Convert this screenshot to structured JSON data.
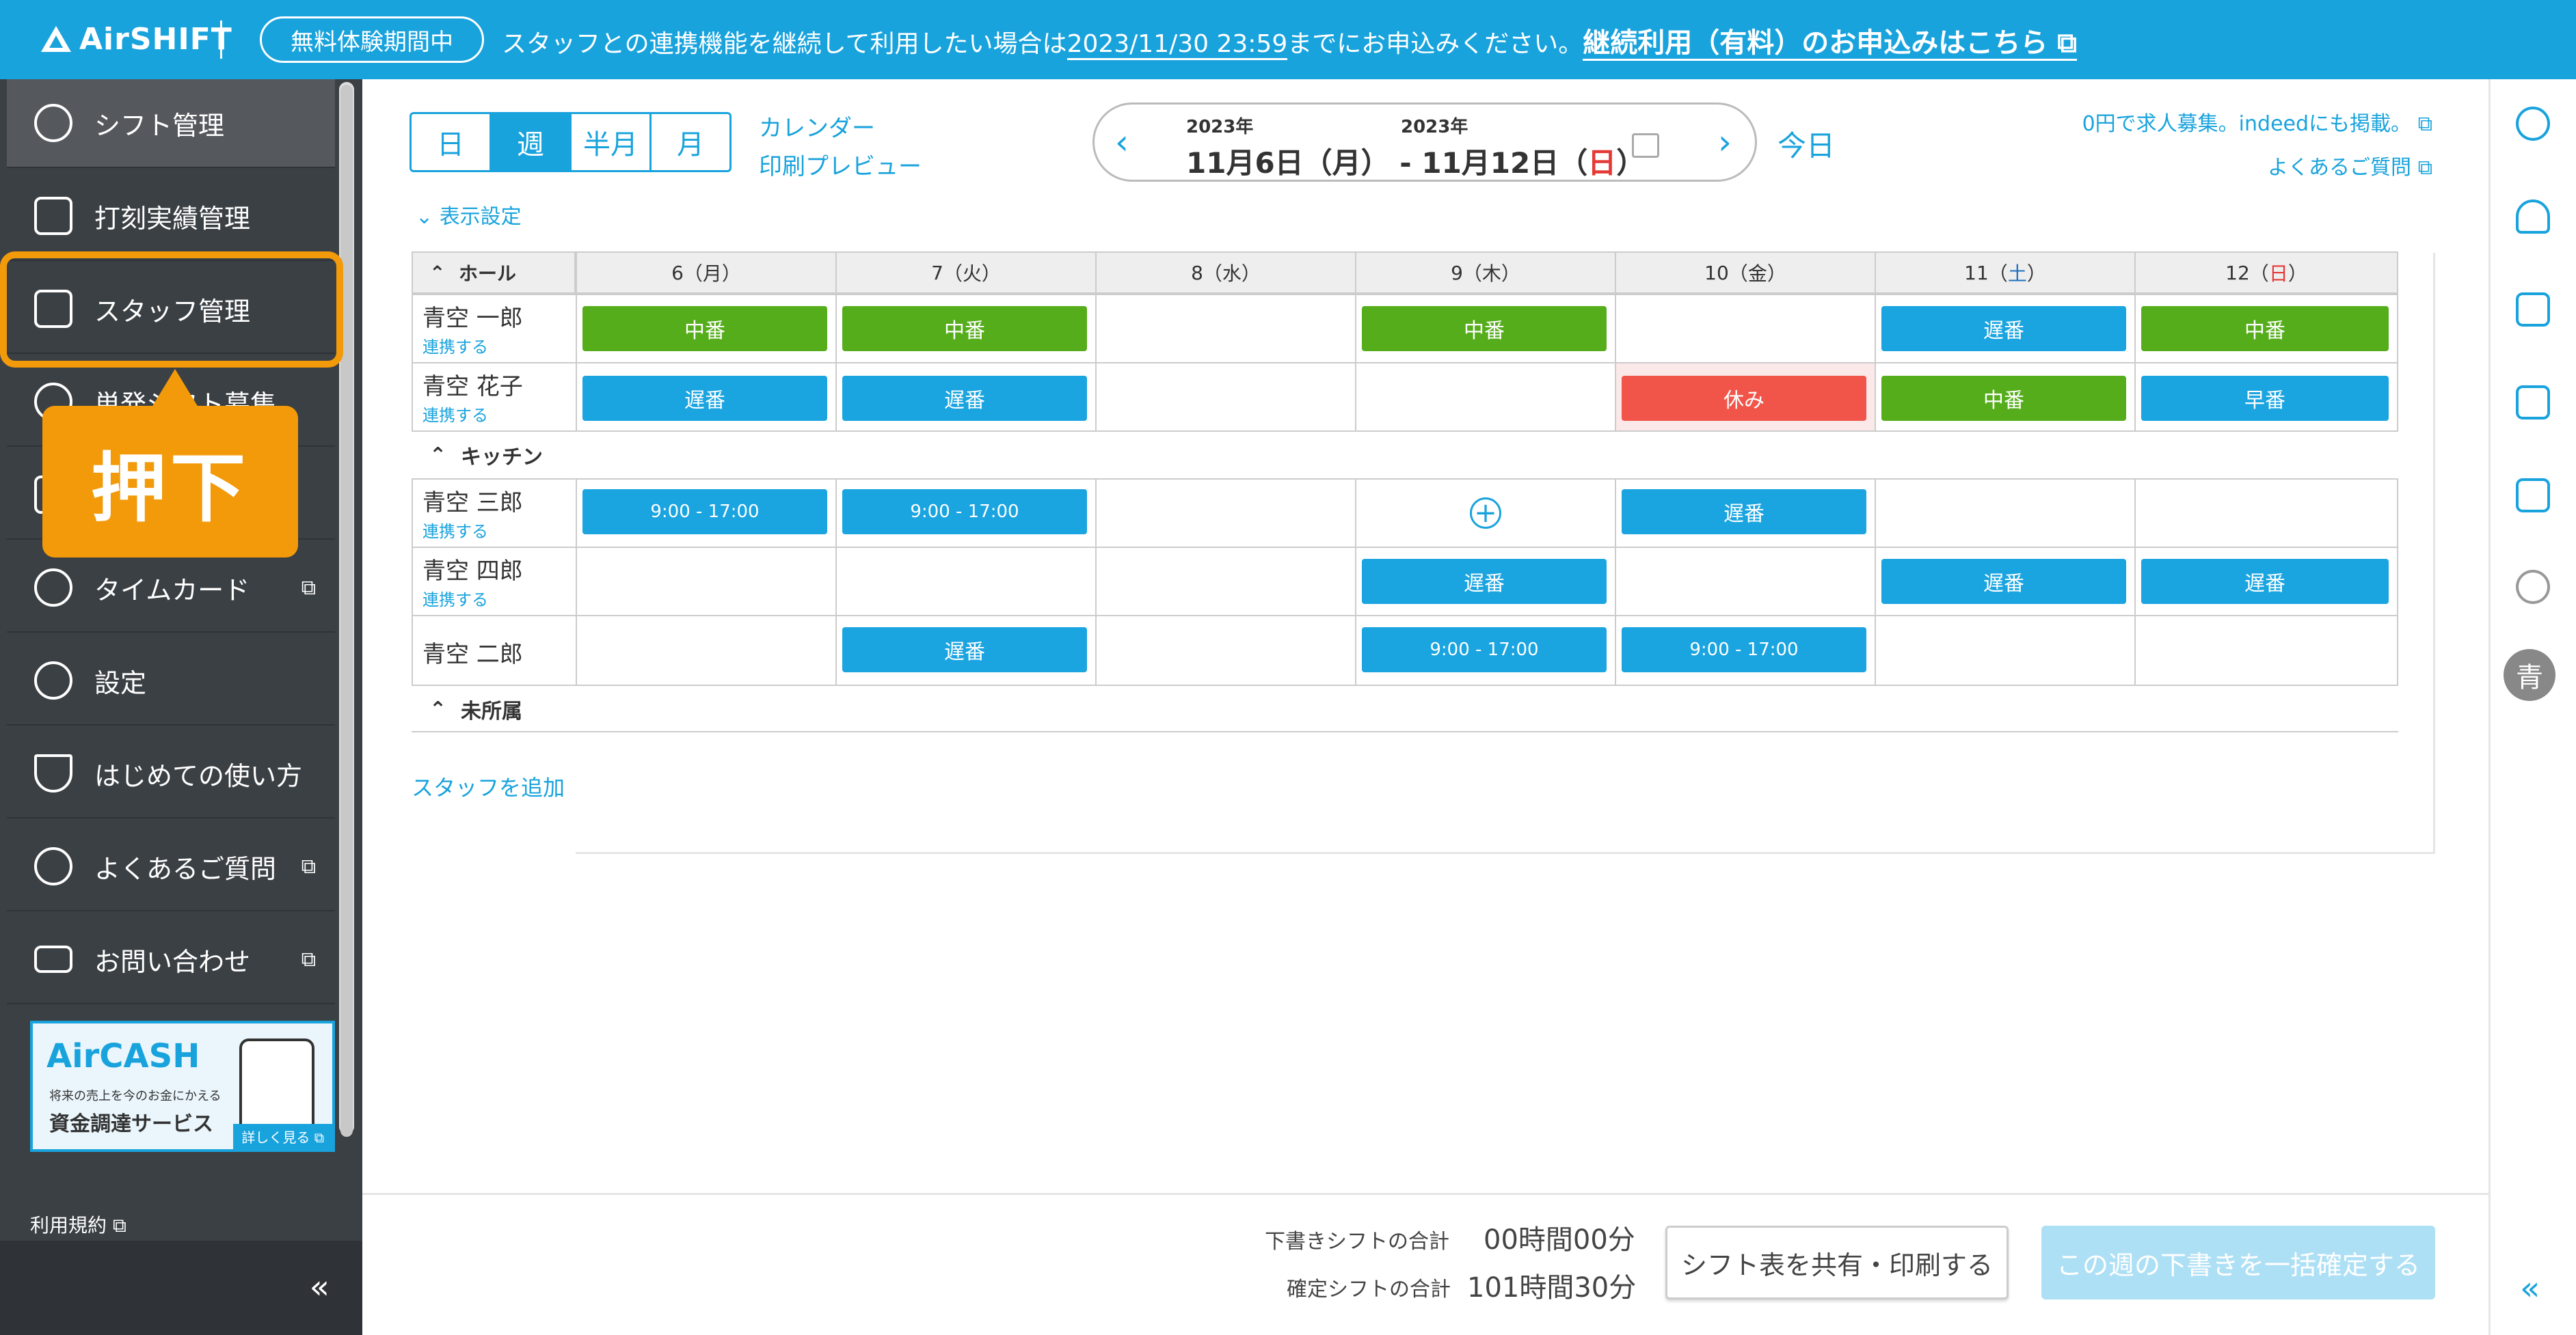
{
  "topbar": {
    "logo": "AirSHIFT",
    "trial_badge": "無料体験期間中",
    "notice_pre": "スタッフとの連携機能を継続して利用したい場合は",
    "notice_date": "2023/11/30 23:59",
    "notice_mid": "までにお申込みください。",
    "notice_link": "継続利用（有料）のお申込みはこちら"
  },
  "sidebar": {
    "items": [
      {
        "label": "シフト管理",
        "icon": "shift-icon"
      },
      {
        "label": "打刻実績管理",
        "icon": "timesheet-icon"
      },
      {
        "label": "スタッフ管理",
        "icon": "staff-card-icon"
      },
      {
        "label": "単発シフト募集",
        "icon": "recruit-icon"
      },
      {
        "label": "",
        "icon": "hidden-icon"
      },
      {
        "label": "タイムカード",
        "icon": "timecard-icon"
      },
      {
        "label": "設定",
        "icon": "gear-icon"
      },
      {
        "label": "はじめての使い方",
        "icon": "beginner-icon"
      },
      {
        "label": "よくあるご質問",
        "icon": "question-icon"
      },
      {
        "label": "お問い合わせ",
        "icon": "mail-icon"
      }
    ],
    "press_label": "押下",
    "aircash": {
      "title": "AirCASH",
      "sub1": "将来の売上を今のお金にかえる",
      "sub2": "資金調達サービス",
      "more": "詳しく見る"
    },
    "terms": "利用規約",
    "collapse": "«"
  },
  "toolbar": {
    "tabs": [
      "日",
      "週",
      "半月",
      "月"
    ],
    "active_tab": "週",
    "calendar_link": "カレンダー",
    "print_link": "印刷プレビュー",
    "year_start": "2023年",
    "year_end": "2023年",
    "range_start": "11月6日（月）",
    "range_sep": "-",
    "range_end_a": "11月12日（",
    "range_end_day": "日",
    "range_end_b": "）",
    "today": "今日",
    "indeed_link": "0円で求人募集。indeedにも掲載。",
    "faq_link": "よくあるご質問",
    "display_settings": "表示設定"
  },
  "schedule": {
    "header_group": "ホール",
    "days": [
      {
        "num": "6",
        "pre": "（",
        "dow": "月",
        "post": "）",
        "color": ""
      },
      {
        "num": "7",
        "pre": "（",
        "dow": "火",
        "post": "）",
        "color": ""
      },
      {
        "num": "8",
        "pre": "（",
        "dow": "水",
        "post": "）",
        "color": ""
      },
      {
        "num": "9",
        "pre": "（",
        "dow": "木",
        "post": "）",
        "color": ""
      },
      {
        "num": "10",
        "pre": "（",
        "dow": "金",
        "post": "）",
        "color": ""
      },
      {
        "num": "11",
        "pre": "（",
        "dow": "土",
        "post": "）",
        "color": "blue"
      },
      {
        "num": "12",
        "pre": "（",
        "dow": "日",
        "post": "）",
        "color": "red"
      }
    ],
    "groups": [
      {
        "name": "ホール"
      },
      {
        "name": "キッチン"
      },
      {
        "name": "未所属"
      }
    ],
    "rows": [
      {
        "name": "青空 一郎",
        "link": "連携する",
        "shifts": [
          "中番",
          "中番",
          "",
          "中番",
          "",
          "遅番",
          "中番"
        ],
        "types": [
          "green",
          "green",
          "",
          "green",
          "",
          "blue",
          "green"
        ]
      },
      {
        "name": "青空 花子",
        "link": "連携する",
        "shifts": [
          "遅番",
          "遅番",
          "",
          "",
          "休み",
          "中番",
          "早番"
        ],
        "types": [
          "blue",
          "blue",
          "",
          "",
          "red",
          "green",
          "blue"
        ]
      },
      {
        "name": "青空 三郎",
        "link": "連携する",
        "shifts": [
          "9:00 - 17:00",
          "9:00 - 17:00",
          "",
          "+",
          "遅番",
          "",
          ""
        ],
        "types": [
          "time",
          "time",
          "",
          "plus",
          "blue",
          "",
          ""
        ]
      },
      {
        "name": "青空 四郎",
        "link": "連携する",
        "shifts": [
          "",
          "",
          "",
          "遅番",
          "",
          "遅番",
          "遅番"
        ],
        "types": [
          "",
          "",
          "",
          "blue",
          "",
          "blue",
          "blue"
        ]
      },
      {
        "name": "青空 二郎",
        "link": "",
        "shifts": [
          "",
          "遅番",
          "",
          "9:00 - 17:00",
          "9:00 - 17:00",
          "",
          ""
        ],
        "types": [
          "",
          "blue",
          "",
          "time",
          "time",
          "",
          ""
        ]
      }
    ],
    "add_staff": "スタッフを追加"
  },
  "footer": {
    "draft_label": "下書きシフトの合計",
    "draft_value": "00時間00分",
    "confirmed_label": "確定シフトの合計",
    "confirmed_value": "101時間30分",
    "share_button": "シフト表を共有・印刷する",
    "confirm_button": "この週の下書きを一括確定する"
  },
  "right_sidebar": {
    "icons": [
      "info-icon",
      "add-user-icon",
      "doc-check-icon",
      "doc-time-icon",
      "staff-check-icon",
      "chat-icon"
    ],
    "avatar": "青",
    "collapse": "«"
  },
  "colors": {
    "brand": "#19a3dd",
    "highlight": "#f39a0a",
    "green": "#56ad1c",
    "red": "#f1554a"
  }
}
